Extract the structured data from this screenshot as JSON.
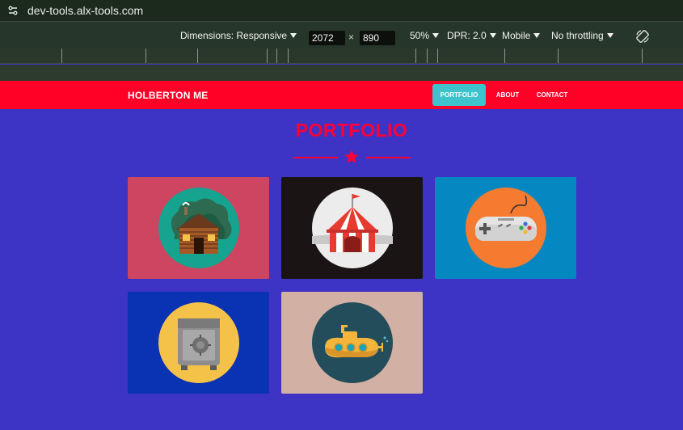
{
  "browser": {
    "url": "dev-tools.alx-tools.com"
  },
  "devtools": {
    "dimensions_label": "Dimensions: Responsive",
    "width_value": "2072",
    "times_symbol": "×",
    "height_value": "890",
    "zoom_label": "50%",
    "dpr_label": "DPR: 2.0",
    "device_label": "Mobile",
    "throttle_label": "No throttling"
  },
  "nav": {
    "brand": "HOLBERTON ME",
    "items": [
      {
        "label": "PORTFOLIO",
        "active": true
      },
      {
        "label": "ABOUT",
        "active": false
      },
      {
        "label": "CONTACT",
        "active": false
      }
    ]
  },
  "portfolio": {
    "title": "PORTFOLIO",
    "cards": [
      {
        "icon": "cabin-icon",
        "bg": "#cd4560"
      },
      {
        "icon": "circus-tent-icon",
        "bg": "#1a1414"
      },
      {
        "icon": "game-controller-icon",
        "bg": "#0588c2"
      },
      {
        "icon": "safe-icon",
        "bg": "#0933b2"
      },
      {
        "icon": "submarine-icon",
        "bg": "#d2b0a3"
      }
    ]
  },
  "colors": {
    "page_bg": "#3d33c4",
    "navbar_bg": "#ff0026",
    "accent": "#ff0033",
    "active_nav_bg": "#3ec2cc"
  }
}
